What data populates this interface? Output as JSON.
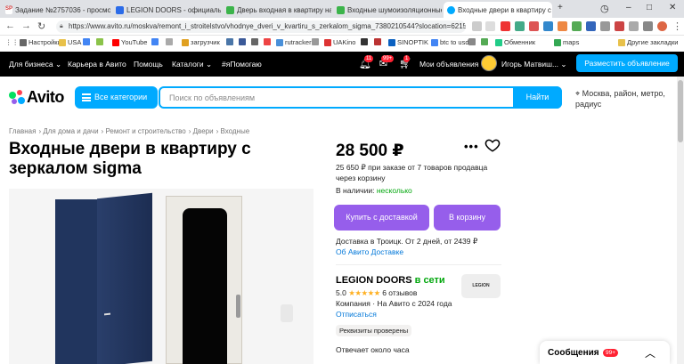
{
  "browser": {
    "tabs": [
      {
        "label": "Задание №2757036 - просмо",
        "favicon": "SP"
      },
      {
        "label": "LEGION DOORS - официальн"
      },
      {
        "label": "Дверь входная в квартиру на"
      },
      {
        "label": "Входные шумоизоляционные"
      },
      {
        "label": "Входные двери в квартиру с"
      }
    ],
    "new_tab": "+",
    "url": "https://www.avito.ru/moskva/remont_i_stroitelstvo/vhodnye_dveri_v_kvartiru_s_zerkalom_sigma_7380210544?slocation=62154...",
    "bookmarks": [
      "Настройки",
      "USA",
      "YouTube",
      "загрузчик",
      "rutracker",
      "UAKino",
      "SINOPTIK",
      "btc to usd",
      "Обменник",
      "maps",
      "Другие закладки"
    ]
  },
  "topnav": {
    "business": "Для бизнеса",
    "career": "Карьера в Авито",
    "help": "Помощь",
    "catalogs": "Каталоги",
    "helping": "#яПомогаю",
    "badges": [
      "11",
      "99+",
      "1"
    ],
    "my_ads": "Мои объявления",
    "user": "Игорь Матвиш...",
    "post_ad": "Разместить объявление"
  },
  "header": {
    "logo": "Avito",
    "categories_button": "Все категории",
    "search_placeholder": "Поиск по объявлениям",
    "search_button": "Найти",
    "location": "Москва, район, метро, радиус"
  },
  "breadcrumb": [
    "Главная",
    "Для дома и дачи",
    "Ремонт и строительство",
    "Двери",
    "Входные"
  ],
  "product": {
    "title": "Входные двери в квартиру с зеркалом sigma",
    "price": "28 500 ₽",
    "bulk_price": "25 650 ₽ при заказе от 7 товаров продавца через корзину",
    "stock_label": "В наличии:",
    "stock_value": "несколько",
    "buy_button": "Купить с доставкой",
    "cart_button": "В корзину",
    "delivery": "Доставка в Троицк. От 2 дней, от 2439 ₽",
    "delivery_link": "Об Авито Доставке"
  },
  "seller": {
    "name": "LEGION DOORS",
    "online": "в сети",
    "logo_text": "LEGION",
    "rating": "5.0",
    "stars": "★★★★★",
    "reviews": "6 отзывов",
    "company": "Компания · На Авито с 2024 года",
    "subscribe": "Отписаться",
    "verified": "Реквизиты проверены",
    "answer": "Отвечает около часа"
  },
  "messages": {
    "label": "Сообщения",
    "count": "99+"
  },
  "colors": {
    "accent": "#00aaff",
    "purple": "#965eeb",
    "green": "#02a70d",
    "link": "#0077d9"
  }
}
